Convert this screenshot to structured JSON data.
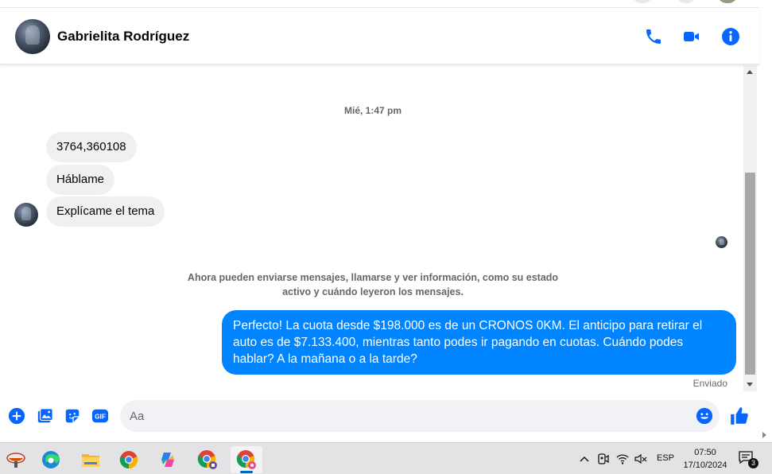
{
  "header": {
    "contact_name": "Gabrielita Rodríguez",
    "icons": [
      "phone-icon",
      "video-camera-icon",
      "info-icon"
    ]
  },
  "conversation": {
    "timestamp": "Mié, 1:47 pm",
    "incoming": [
      {
        "text": "3764,360108"
      },
      {
        "text": "Háblame"
      },
      {
        "text": "Explícame el tema"
      }
    ],
    "notice": "Ahora pueden enviarse mensajes, llamarse y ver información, como su estado activo y cuándo leyeron los mensajes.",
    "outgoing": {
      "text": "Perfecto! La cuota desde $198.000 es de un CRONOS 0KM. El anticipo para retirar el auto es de $7.133.400, mientras tanto podes ir pagando en cuotas. Cuándo podes hablar? A la mañana o a la tarde?",
      "status": "Enviado"
    }
  },
  "composer": {
    "placeholder": "Aa",
    "value": "",
    "icons": [
      "plus-icon",
      "image-icon",
      "sticker-icon",
      "gif-icon",
      "emoji-icon",
      "thumbs-up-icon"
    ],
    "gif_label": "GIF"
  },
  "colors": {
    "accent": "#0084ff",
    "icon_blue": "#0866ff",
    "bubble_in": "#f0f0f0",
    "secondary_text": "#65676b"
  },
  "taskbar": {
    "apps": [
      "start-icon",
      "edge-icon",
      "file-explorer-icon",
      "chrome-icon",
      "copilot-icon",
      "chrome-profile-icon",
      "chrome-active-icon"
    ],
    "language": "ESP",
    "time": "07:50",
    "date": "17/10/2024",
    "notification_count": "3"
  }
}
